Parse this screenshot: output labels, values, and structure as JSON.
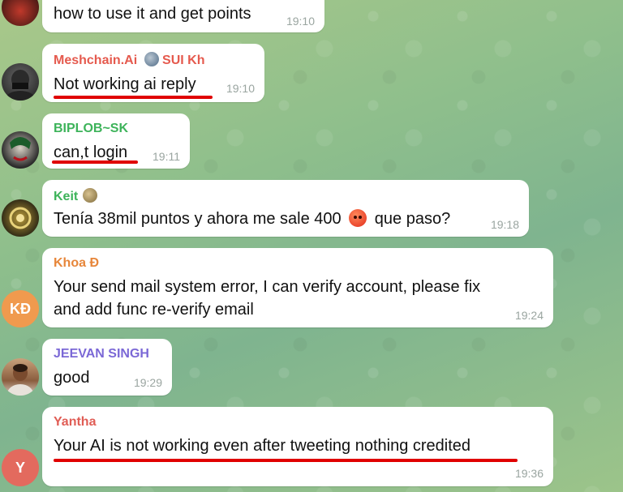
{
  "messages": [
    {
      "sender": "",
      "text": "how to use it and get points",
      "time": "19:10"
    },
    {
      "sender": "Meshchain.Ai",
      "sender_suffix": "SUI Kh",
      "sender_color": "#e55a4e",
      "text": "Not working ai reply",
      "time": "19:10",
      "avatar_icon": "masked-man-avatar"
    },
    {
      "sender": "BIPLOB~SK",
      "sender_color": "#3db35a",
      "text": "can,t login",
      "time": "19:11",
      "avatar_icon": "joker-avatar"
    },
    {
      "sender": "Keit",
      "sender_color": "#3db35a",
      "text_before": "Tenía 38mil puntos y ahora me sale 400",
      "text_after": "que paso?",
      "time": "19:18",
      "avatar_icon": "gold-emblem-avatar"
    },
    {
      "sender": "Khoa Đ",
      "sender_color": "#e7863a",
      "text_line1": "Your send mail system error, I can verify account, please fix",
      "text_line2": "and add func re-verify email",
      "time": "19:24",
      "avatar_initials": "KĐ",
      "avatar_color": "#f09a4e"
    },
    {
      "sender": "JEEVAN SINGH",
      "sender_color": "#7b68d6",
      "text": "good",
      "time": "19:29",
      "avatar_icon": "man-photo-avatar"
    },
    {
      "sender": "Yantha",
      "sender_color": "#e05d55",
      "text": "Your AI is not working even after tweeting nothing credited",
      "time": "19:36",
      "avatar_initials": "Y",
      "avatar_color": "#e36a5e"
    }
  ],
  "colors": {
    "highlight_underline": "#e00000",
    "bubble_bg": "#ffffff",
    "time_color": "#9aa5a0"
  }
}
